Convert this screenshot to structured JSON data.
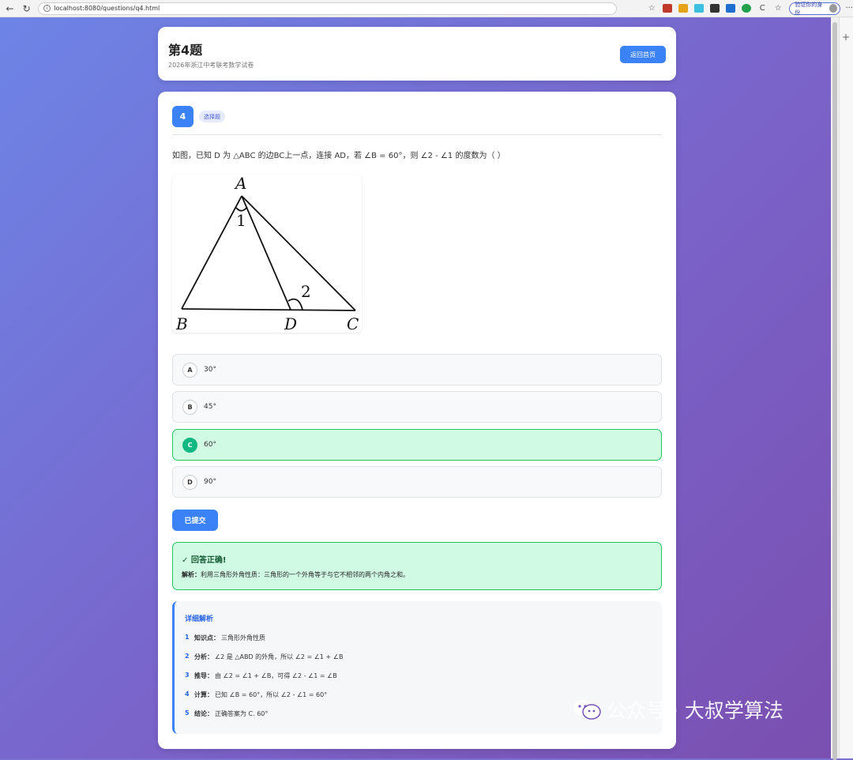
{
  "browser": {
    "url": "localhost:8080/questions/q4.html",
    "profile_label": "验证你的身份"
  },
  "header": {
    "title": "第4题",
    "subtitle": "2026年浙江中考联考数学试卷",
    "home_button": "返回首页"
  },
  "question": {
    "number": "4",
    "type_badge": "选择题",
    "text": "如图，已知 D 为 △ABC 的边BC上一点，连接 AD，若 ∠B = 60°，则 ∠2 - ∠1 的度数为（ ）",
    "figure_labels": {
      "A": "A",
      "B": "B",
      "C": "C",
      "D": "D",
      "angle1": "1",
      "angle2": "2"
    }
  },
  "options": [
    {
      "letter": "A",
      "text": "30°",
      "correct": false
    },
    {
      "letter": "B",
      "text": "45°",
      "correct": false
    },
    {
      "letter": "C",
      "text": "60°",
      "correct": true
    },
    {
      "letter": "D",
      "text": "90°",
      "correct": false
    }
  ],
  "submit_button": "已提交",
  "result": {
    "title": "✓ 回答正确!",
    "explanation_label": "解析：",
    "explanation": "利用三角形外角性质：三角形的一个外角等于与它不相邻的两个内角之和。"
  },
  "detail": {
    "title": "详细解析",
    "steps": [
      {
        "num": "1",
        "label": "知识点：",
        "text": "三角形外角性质"
      },
      {
        "num": "2",
        "label": "分析：",
        "text": "∠2 是 △ABD 的外角，所以 ∠2 = ∠1 + ∠B"
      },
      {
        "num": "3",
        "label": "推导：",
        "text": "由 ∠2 = ∠1 + ∠B，可得 ∠2 - ∠1 = ∠B"
      },
      {
        "num": "4",
        "label": "计算：",
        "text": "已知 ∠B = 60°，所以 ∠2 - ∠1 = 60°"
      },
      {
        "num": "5",
        "label": "结论：",
        "text": "正确答案为 C. 60°"
      }
    ]
  },
  "watermark": "公众号 · 大叔学算法",
  "colors": {
    "primary": "#3b82f6",
    "correct_bg": "#d1fae5",
    "correct_border": "#22c55e",
    "correct_letter": "#10b981"
  }
}
